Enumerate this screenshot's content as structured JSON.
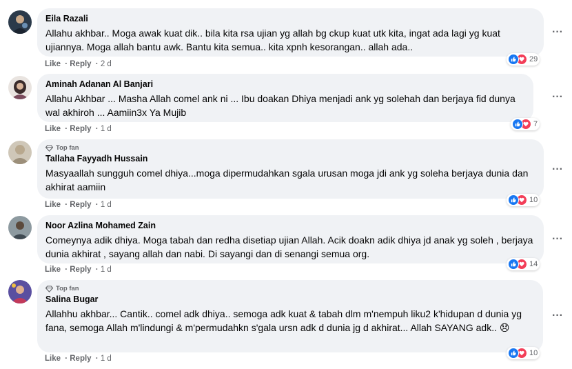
{
  "colors": {
    "like_blue": "#1877f2",
    "love_red": "#f33e58",
    "bubble_bg": "#f0f2f5",
    "muted": "#65676b"
  },
  "icons": {
    "more": "more-options-icon",
    "like": "like-reaction-icon",
    "love": "love-reaction-icon",
    "top_fan": "diamond-icon"
  },
  "comments": [
    {
      "name": "Eila Razali",
      "top_fan": "",
      "text": "Allahu akhbar.. Moga awak kuat dik.. bila kita rsa ujian yg allah bg ckup kuat utk kita, ingat ada lagi yg kuat ujiannya. Moga allah bantu awk. Bantu kita semua.. kita xpnh kesorangan.. allah ada..",
      "like": "Like",
      "reply": "Reply",
      "time": "2 d",
      "reactions": "29",
      "more": "···"
    },
    {
      "name": "Aminah Adanan Al Banjari",
      "top_fan": "",
      "text": "Allahu Akhbar ... Masha Allah comel ank ni ... Ibu doakan Dhiya menjadi ank yg solehah dan berjaya fid dunya wal akhiroh ... Aamiin3x Ya Mujib",
      "like": "Like",
      "reply": "Reply",
      "time": "1 d",
      "reactions": "7",
      "more": "···"
    },
    {
      "name": "Tallaha Fayyadh Hussain",
      "top_fan": "Top fan",
      "text": "Masyaallah sungguh comel dhiya...moga dipermudahkan sgala urusan moga jdi ank yg soleha berjaya dunia dan akhirat aamiin",
      "like": "Like",
      "reply": "Reply",
      "time": "1 d",
      "reactions": "10",
      "more": "···"
    },
    {
      "name": "Noor Azlina Mohamed Zain",
      "top_fan": "",
      "text": "Comeynya adik dhiya. Moga tabah dan redha disetiap ujian Allah. Acik doakn adik dhiya jd anak yg soleh , berjaya dunia akhirat , sayang allah dan nabi. Di sayangi dan di senangi semua org.",
      "like": "Like",
      "reply": "Reply",
      "time": "1 d",
      "reactions": "14",
      "more": "···"
    },
    {
      "name": "Salina Bugar",
      "top_fan": "Top fan",
      "text": "Allahhu akhbar... Cantik.. comel adk dhiya.. semoga adk kuat & tabah dlm m'nempuh liku2 k'hidupan d dunia yg fana, semoga Allah m'lindungi & m'permudahkn s'gala ursn adk d dunia jg d akhirat... Allah SAYANG adk.. 😞",
      "like": "Like",
      "reply": "Reply",
      "time": "1 d",
      "reactions": "10",
      "more": "···"
    }
  ]
}
